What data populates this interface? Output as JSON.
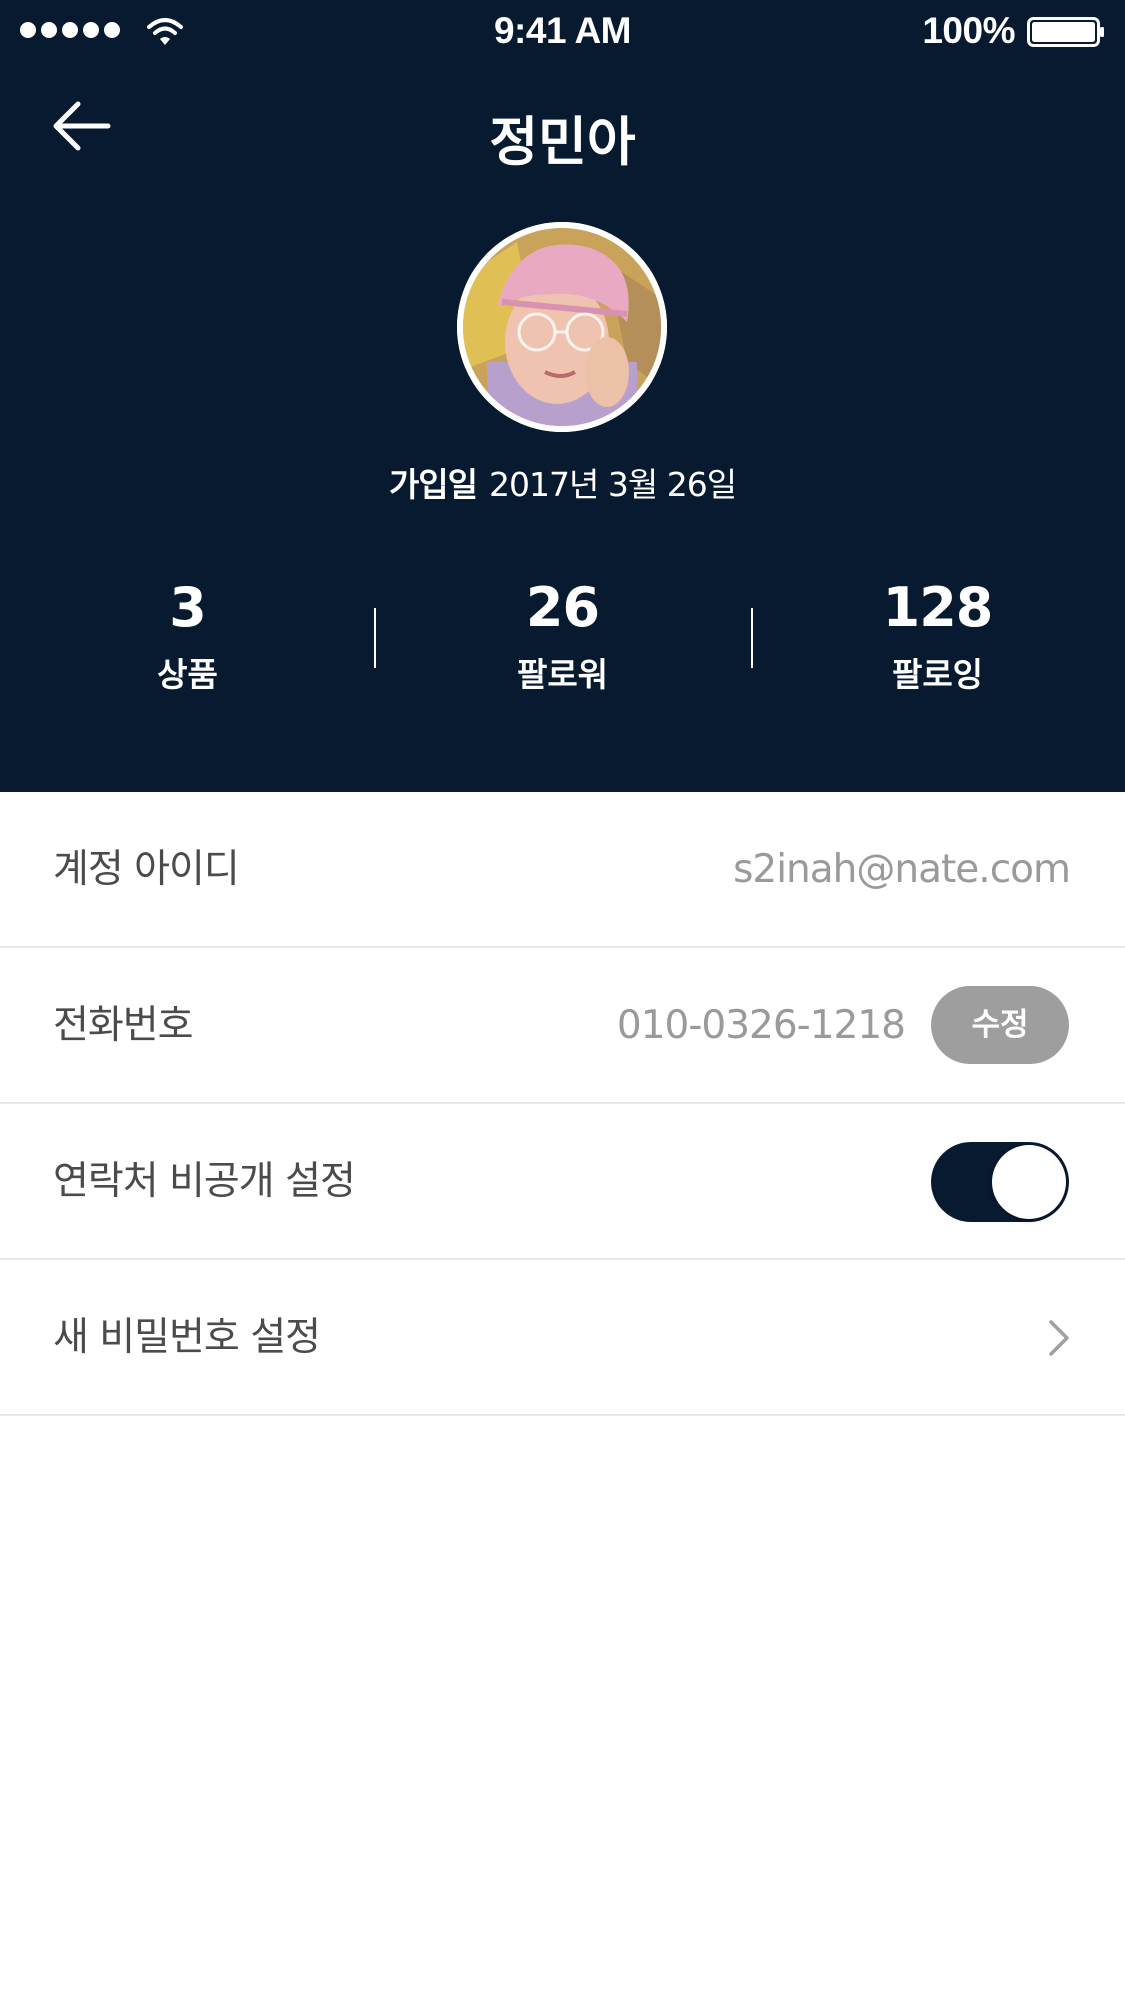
{
  "status_bar": {
    "time": "9:41 AM",
    "battery": "100%",
    "signal_bars": 5,
    "battery_level": 1.0
  },
  "header": {
    "back_icon": "arrow-left-icon",
    "title": "정민아",
    "join_label": "가입일",
    "join_date": "2017년 3월 26일",
    "background_color": "#081a2f"
  },
  "stats": [
    {
      "value": "3",
      "label": "상품"
    },
    {
      "value": "26",
      "label": "팔로워"
    },
    {
      "value": "128",
      "label": "팔로잉"
    }
  ],
  "settings": {
    "account_id": {
      "label": "계정 아이디",
      "value": "s2inah@nate.com"
    },
    "phone": {
      "label": "전화번호",
      "value": "010-0326-1218",
      "edit_label": "수정"
    },
    "contact_private": {
      "label": "연락처 비공개 설정",
      "enabled": true
    },
    "new_password": {
      "label": "새 비밀번호 설정",
      "icon": "chevron-right-icon"
    }
  },
  "colors": {
    "header_bg": "#081a2f",
    "label_text": "#4b4b4b",
    "value_text": "#9a9a9a",
    "edit_button_bg": "#9e9e9e",
    "divider": "#e9e9e9"
  }
}
